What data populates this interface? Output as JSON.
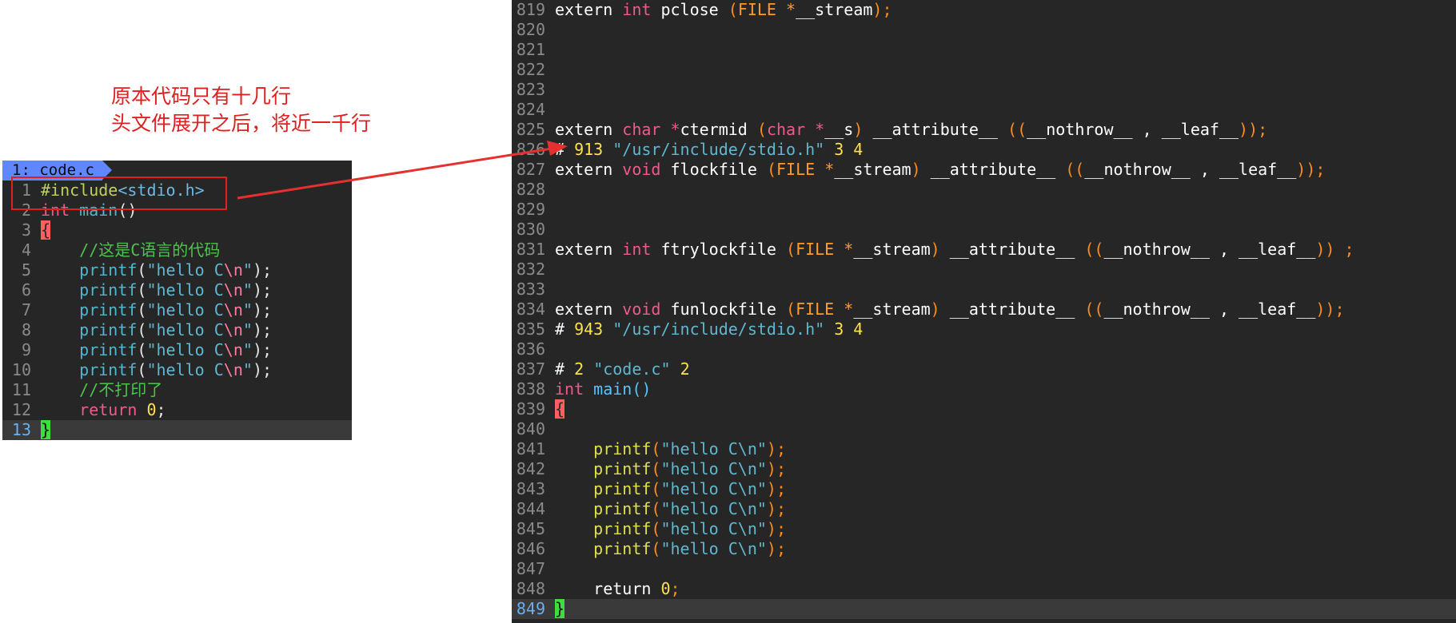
{
  "annotation": {
    "line1": "原本代码只有十几行",
    "line2": "头文件展开之后，将近一千行"
  },
  "left_editor": {
    "tab_label": "1: code.c",
    "lines": [
      {
        "n": "1"
      },
      {
        "n": "2"
      },
      {
        "n": "3"
      },
      {
        "n": "4"
      },
      {
        "n": "5"
      },
      {
        "n": "6"
      },
      {
        "n": "7"
      },
      {
        "n": "8"
      },
      {
        "n": "9"
      },
      {
        "n": "10"
      },
      {
        "n": "11"
      },
      {
        "n": "12"
      },
      {
        "n": "13"
      }
    ],
    "code": {
      "include_directive": "#include",
      "include_header": "<stdio.h>",
      "int_kw": "int",
      "main_fn": "main",
      "parens": "()",
      "open_brace": "{",
      "comment1": "//这是C语言的代码",
      "printf": "printf",
      "hello_str": "\"hello C",
      "newline_esc": "\\n",
      "str_close": "\"",
      "call_end": ");",
      "comment2": "//不打印了",
      "return_kw": "return",
      "zero": "0",
      "semicolon": ";",
      "close_brace": "}"
    }
  },
  "right_editor": {
    "lines": [
      {
        "n": "819"
      },
      {
        "n": "820"
      },
      {
        "n": "821"
      },
      {
        "n": "822"
      },
      {
        "n": "823"
      },
      {
        "n": "824"
      },
      {
        "n": "825"
      },
      {
        "n": "826"
      },
      {
        "n": "827"
      },
      {
        "n": "828"
      },
      {
        "n": "829"
      },
      {
        "n": "830"
      },
      {
        "n": "831"
      },
      {
        "n": "832"
      },
      {
        "n": "833"
      },
      {
        "n": "834"
      },
      {
        "n": "835"
      },
      {
        "n": "836"
      },
      {
        "n": "837"
      },
      {
        "n": "838"
      },
      {
        "n": "839"
      },
      {
        "n": "840"
      },
      {
        "n": "841"
      },
      {
        "n": "842"
      },
      {
        "n": "843"
      },
      {
        "n": "844"
      },
      {
        "n": "845"
      },
      {
        "n": "846"
      },
      {
        "n": "847"
      },
      {
        "n": "848"
      },
      {
        "n": "849"
      }
    ],
    "code": {
      "extern": "extern",
      "int": "int",
      "char": "char",
      "void": "void",
      "pclose": "pclose",
      "ctermid": "ctermid",
      "flockfile": "flockfile",
      "ftrylockfile": "ftrylockfile",
      "funlockfile": "funlockfile",
      "file_type": "FILE",
      "star": "*",
      "stream_param": "__stream",
      "s_param": "__s",
      "attribute": "__attribute__",
      "nothrow": "__nothrow__",
      "leaf": "__leaf__",
      "comma": ",",
      "line_marker_hash": "#",
      "marker_913": "913",
      "marker_943": "943",
      "marker_2": "2",
      "stdio_path": "\"/usr/include/stdio.h\"",
      "code_c": "\"code.c\"",
      "flags_34": "3 4",
      "flag_2": "2",
      "main": "main",
      "printf": "printf",
      "hello_str": "\"hello C\\n\"",
      "return_kw": "return",
      "zero": "0"
    }
  },
  "colors": {
    "editor_bg": "#262626",
    "annotation": "#e02020",
    "tab_bg": "#5f87ff",
    "keyword": "#f05a8a",
    "comment": "#4ec24e",
    "string": "#5fb8d0",
    "number": "#ffe14a",
    "paren": "#ff8c1a"
  }
}
